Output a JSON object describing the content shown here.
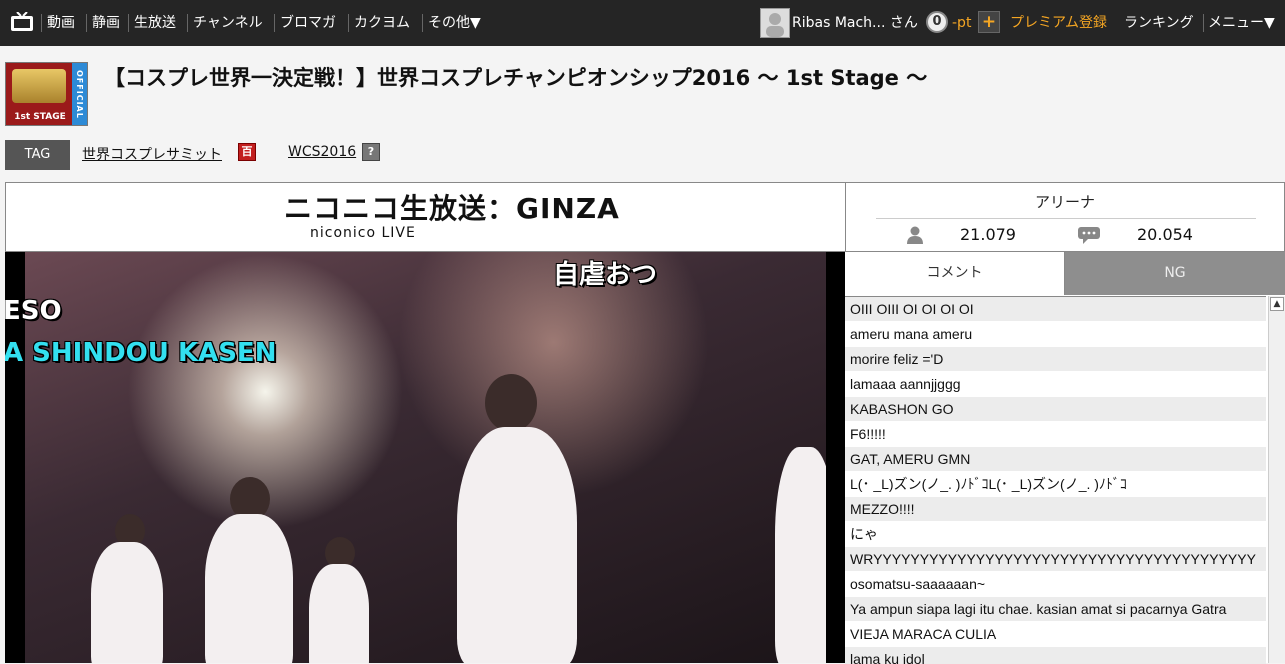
{
  "nav": {
    "items": [
      "動画",
      "静画",
      "生放送",
      "チャンネル",
      "ブロマガ",
      "カクヨム",
      "その他▼"
    ],
    "user_name": "Ribas Mach... さん",
    "points": "0",
    "points_unit": "-pt",
    "plus": "+",
    "premium": "プレミアム登録",
    "ranking": "ランキング",
    "menu": "メニュー▼"
  },
  "thumb": {
    "stage": "1st STAGE",
    "official": "OFFICIAL"
  },
  "title": "【コスプレ世界一決定戦！】世界コスプレチャンピオンシップ2016 ～ 1st Stage ～",
  "tags": {
    "label": "TAG",
    "items": [
      {
        "text": "世界コスプレサミット",
        "icon": "百"
      },
      {
        "text": "WCS2016",
        "icon": "?"
      }
    ]
  },
  "channel": {
    "brand_main": "ニコニコ生放送：GINZA",
    "brand_sub": "niconico LIVE"
  },
  "stats": {
    "room": "アリーナ",
    "viewers": "21.079",
    "comments": "20.054"
  },
  "video": {
    "caption_top": "自虐おつ",
    "caption_left_1": "ESO",
    "caption_left_2": "A SHINDOU KASEN"
  },
  "comment_tabs": {
    "comment": "コメント",
    "ng": "NG"
  },
  "comments": [
    "OIII OIII OI OI OI OI",
    "ameru mana ameru",
    "morire feliz ='D",
    "lamaaa aannjjggg",
    "KABASHON GO",
    "F6!!!!!",
    "GAT, AMERU GMN",
    "L(･ _L)ズン(ノ_. )ﾉﾄﾞｺL(･ _L)ズン(ノ_. )ﾉﾄﾞｺ",
    "MEZZO!!!!",
    "にゃ",
    "WRYYYYYYYYYYYYYYYYYYYYYYYYYYYYYYYYYYYYYYYYY",
    "osomatsu-saaaaaan~",
    "Ya ampun siapa lagi itu chae. kasian amat si pacarnya Gatra",
    "VIEJA MARACA CULIA",
    "lama ku idol"
  ],
  "colors": {
    "nav_bg": "#252525",
    "accent_orange": "#f5a623",
    "tab_inactive": "#8e8e8e"
  }
}
